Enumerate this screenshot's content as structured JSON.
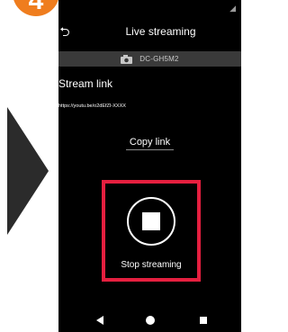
{
  "step": {
    "number": "4",
    "color": "#ef7d1e"
  },
  "screen": {
    "status_icon": "signal-icon",
    "back_icon": "back-arrow-icon",
    "title": "Live streaming",
    "device": {
      "icon": "camera-icon",
      "name": "DC-GH5M2"
    },
    "stream_link": {
      "label": "Stream link",
      "url": "https://youtu.be/o2dEfZI-XXXX",
      "copy_label": "Copy link"
    },
    "stop": {
      "icon": "stop-icon",
      "label": "Stop streaming",
      "highlight_color": "#e51f3f"
    },
    "nav": {
      "back_icon": "nav-back-icon",
      "home_icon": "nav-home-icon",
      "recents_icon": "nav-recents-icon"
    }
  }
}
